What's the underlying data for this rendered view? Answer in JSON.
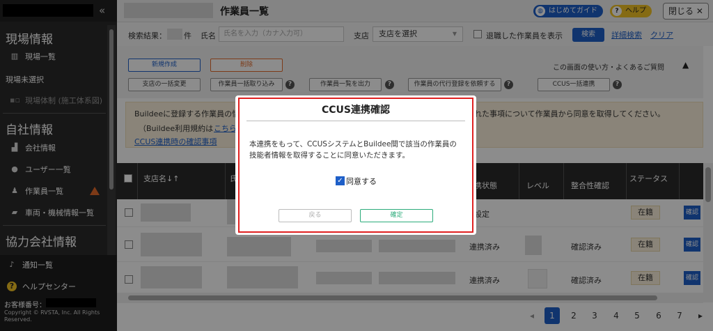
{
  "sidebar": {
    "collapse": "«",
    "sections": [
      {
        "title": "現場情報"
      },
      {
        "title": "自社情報"
      },
      {
        "title": "協力会社情報"
      }
    ],
    "genba_items": [
      "現場一覧"
    ],
    "genba_unselected": "現場未選択",
    "genba_system": "現場体制 (施工体系図)",
    "jisha_items": [
      "会社情報",
      "ユーザー一覧",
      "作業員一覧",
      "車両・機械情報一覧"
    ],
    "bottom": {
      "notices": "通知一覧",
      "help": "ヘルプセンター",
      "customer_no": "お客様番号：",
      "copyright": "Copyright © RVSTA, Inc. All Rights Reserved."
    }
  },
  "header": {
    "title": "作業員一覧",
    "guide": "はじめてガイド",
    "help": "ヘルプ",
    "close": "閉じる"
  },
  "search": {
    "result_label": "検索結果：",
    "count_unit": "件",
    "name_label": "氏名",
    "name_placeholder": "氏名を入力（カナ入力可）",
    "branch_label": "支店",
    "branch_value": "支店を選択",
    "retired_label": "退職した作業員を表示",
    "search_btn": "検索",
    "advanced": "詳細検索",
    "clear": "クリア"
  },
  "toolbar": {
    "new": "新規作成",
    "delete": "削除",
    "help_link": "この画面の使い方・よくあるご質問",
    "bulk_branch": "支店の一括変更",
    "bulk_import": "作業員一括取り込み",
    "export": "作業員一覧を出力",
    "proxy": "作業員の代行登録を依頼する",
    "ccus_bulk": "CCUS一括連携"
  },
  "notice": {
    "line1_a": "Buildeeに登録する作業員の情",
    "line1_b": "れた事項について作業員から同意を取得してください。",
    "line2_a": "（Buildee利用規約は",
    "line2_link": "こちら",
    "line3_link": "CCUS連携時の確認事項"
  },
  "table": {
    "headers": [
      "支店名↓↑",
      "氏",
      "連携状態",
      "レベル",
      "整合性確認",
      "ステータス"
    ],
    "rows": [
      {
        "link": "未設定",
        "check": "",
        "status": "在籍",
        "action": "確認"
      },
      {
        "link": "連携済み",
        "check": "確認済み",
        "status": "在籍",
        "action": "確認"
      },
      {
        "link": "連携済み",
        "check": "確認済み",
        "status": "在籍",
        "action": "確認"
      }
    ]
  },
  "pagination": {
    "prev": "◂",
    "pages": [
      "1",
      "2",
      "3",
      "4",
      "5",
      "6",
      "7"
    ],
    "next": "▸",
    "current": "1"
  },
  "modal": {
    "title": "CCUS連携確認",
    "body": "本連携をもって、CCUSシステムとBuildee間で該当の作業員の技能者情報を取得することに同意いただきます。",
    "agree": "同意する",
    "back": "戻る",
    "confirm": "確定"
  },
  "colors": {
    "accent": "#1e5fc8",
    "danger": "#e02020",
    "confirm": "#2bab7a",
    "warn": "#e36b2b"
  }
}
